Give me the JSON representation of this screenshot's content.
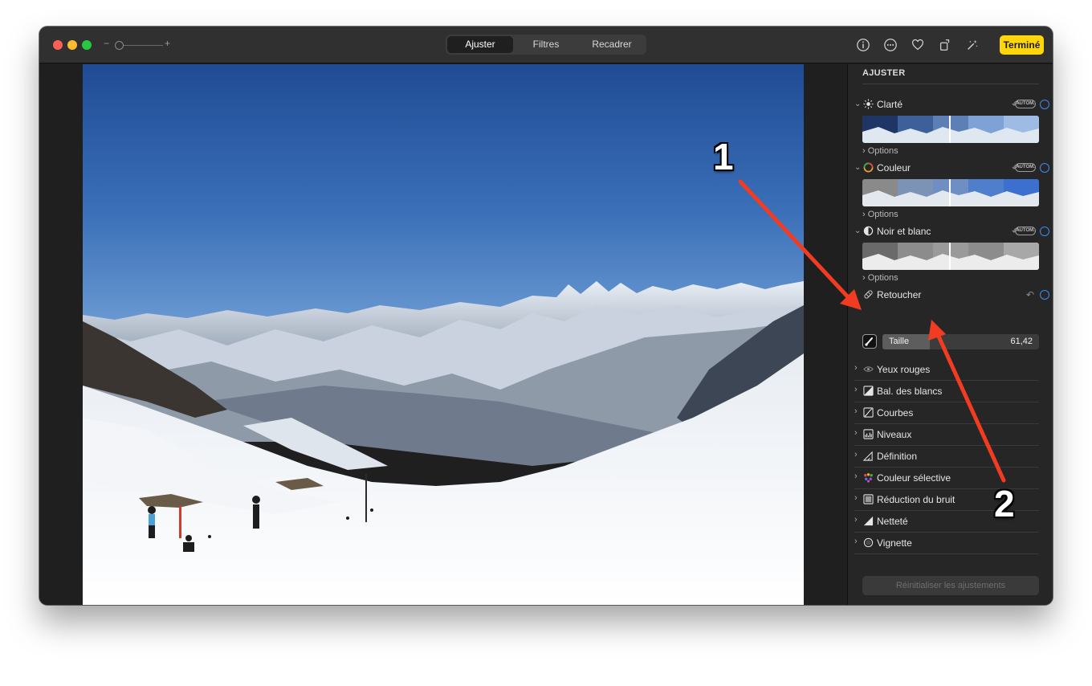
{
  "toolbar": {
    "zoom_minus": "−",
    "zoom_plus": "+",
    "tabs": [
      {
        "label": "Ajuster",
        "active": true
      },
      {
        "label": "Filtres",
        "active": false
      },
      {
        "label": "Recadrer",
        "active": false
      }
    ],
    "icons": [
      "info-icon",
      "more-icon",
      "heart-icon",
      "rotate-icon",
      "magic-wand-icon"
    ],
    "done_label": "Terminé",
    "done_color": "#ffd60a"
  },
  "sidebar": {
    "title": "AJUSTER",
    "sections": [
      {
        "label": "Clarté",
        "icon": "sun-icon",
        "revert": "↶",
        "auto": "AUTOM.",
        "options": "Options"
      },
      {
        "label": "Couleur",
        "icon": "color-circle-icon",
        "revert": "↶",
        "auto": "AUTOM.",
        "options": "Options"
      },
      {
        "label": "Noir et blanc",
        "icon": "half-circle-icon",
        "revert": "↶",
        "auto": "AUTOM.",
        "options": "Options"
      }
    ],
    "retouch": {
      "label": "Retoucher",
      "revert": "↶",
      "slider_label": "Taille",
      "slider_value": "61,42",
      "slider_fraction": 0.3
    },
    "rows": [
      {
        "label": "Yeux rouges",
        "icon": "eye-icon"
      },
      {
        "label": "Bal. des blancs",
        "icon": "white-balance-icon"
      },
      {
        "label": "Courbes",
        "icon": "curves-icon"
      },
      {
        "label": "Niveaux",
        "icon": "levels-icon"
      },
      {
        "label": "Définition",
        "icon": "definition-icon"
      },
      {
        "label": "Couleur sélective",
        "icon": "selective-color-icon"
      },
      {
        "label": "Réduction du bruit",
        "icon": "noise-icon"
      },
      {
        "label": "Netteté",
        "icon": "sharpness-icon"
      },
      {
        "label": "Vignette",
        "icon": "vignette-icon"
      }
    ],
    "reset_label": "Réinitialiser les ajustements"
  },
  "annotations": {
    "one": "1",
    "two": "2",
    "arrow_color": "#f23c22"
  }
}
